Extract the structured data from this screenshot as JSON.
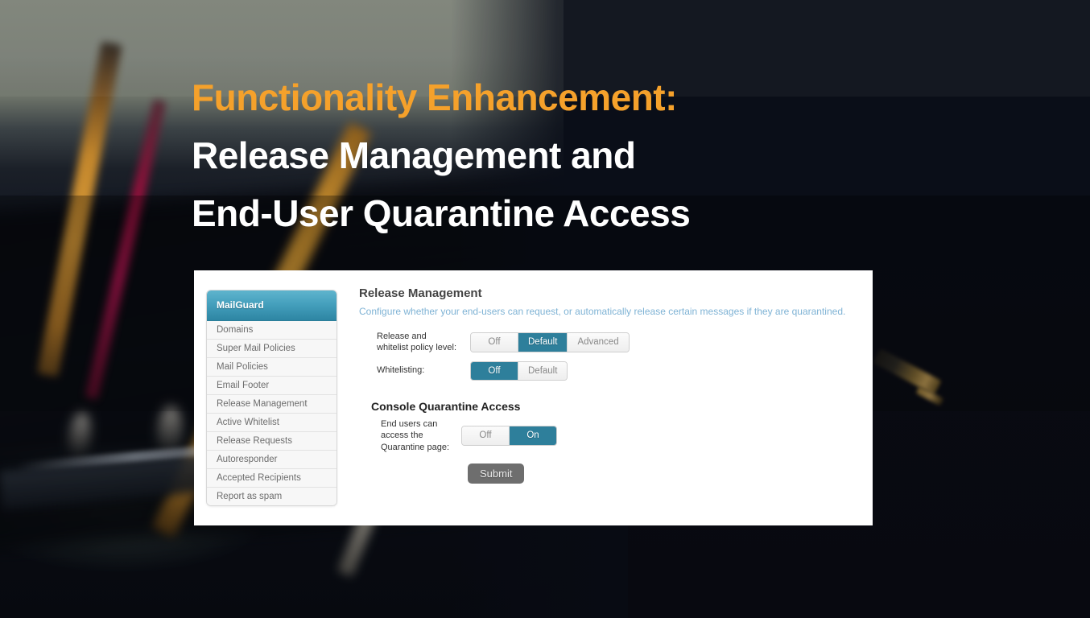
{
  "hero": {
    "line1": "Functionality Enhancement:",
    "line2": "Release Management and",
    "line3": "End-User Quarantine Access",
    "accent_color": "#f5a12b",
    "text_color": "#ffffff"
  },
  "app": {
    "sidebar": {
      "brand": "MailGuard",
      "items": [
        {
          "label": "Domains"
        },
        {
          "label": "Super Mail Policies"
        },
        {
          "label": "Mail Policies"
        },
        {
          "label": "Email Footer"
        },
        {
          "label": "Release Management"
        },
        {
          "label": "Active Whitelist"
        },
        {
          "label": "Release Requests"
        },
        {
          "label": "Autoresponder"
        },
        {
          "label": "Accepted Recipients"
        },
        {
          "label": "Report as spam"
        }
      ]
    },
    "main": {
      "title": "Release Management",
      "description": "Configure whether your end-users can request, or automatically release certain messages if they are quarantined.",
      "fields": [
        {
          "label_line1": "Release and",
          "label_line2": "whitelist policy level:",
          "options": [
            "Off",
            "Default",
            "Advanced"
          ],
          "selected": "Default"
        },
        {
          "label_line1": "Whitelisting:",
          "label_line2": "",
          "options": [
            "Off",
            "Default"
          ],
          "selected": "Off"
        }
      ],
      "section2": {
        "title": "Console Quarantine Access",
        "label_line1": "End users can",
        "label_line2": "access the",
        "label_line3": "Quarantine page:",
        "options": [
          "Off",
          "On"
        ],
        "selected": "On"
      },
      "submit_label": "Submit",
      "accent_color": "#2e7f9b",
      "description_color": "#7fb3d5"
    }
  }
}
